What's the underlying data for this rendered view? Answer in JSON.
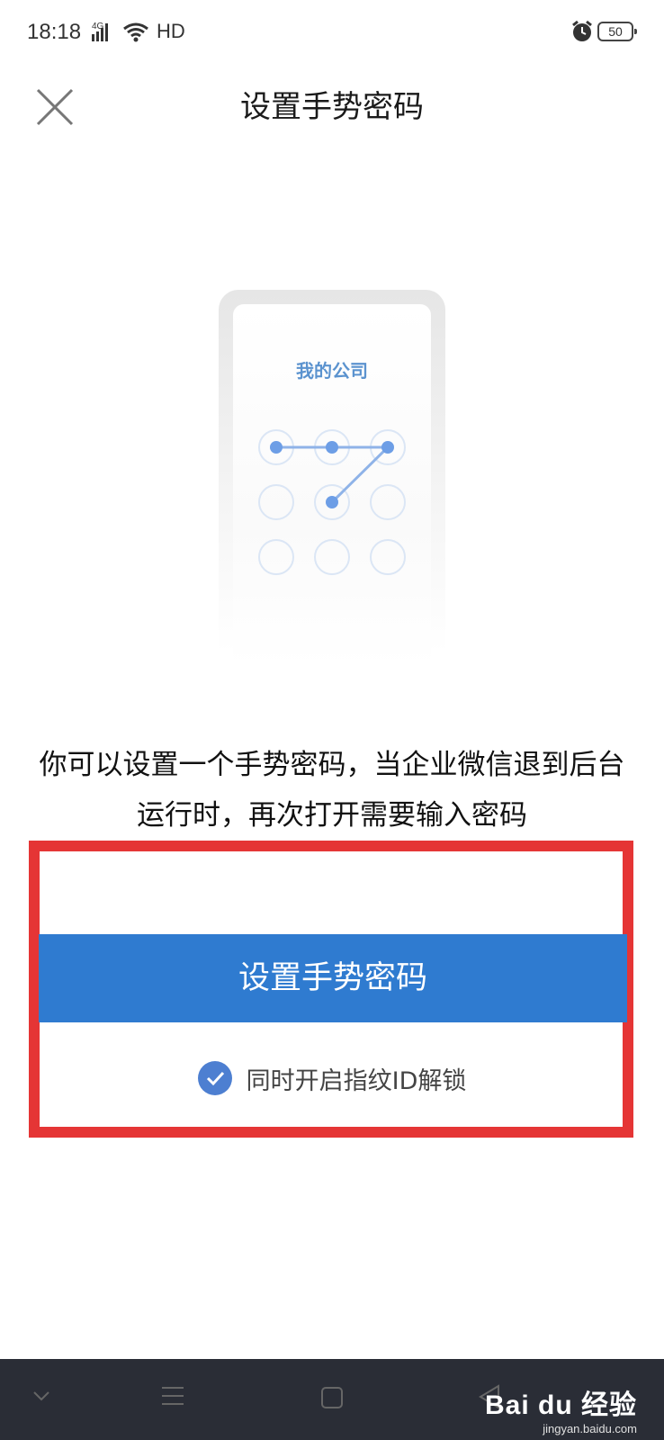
{
  "status_bar": {
    "time": "18:18",
    "network": "4G",
    "hd": "HD",
    "battery": "50"
  },
  "nav": {
    "title": "设置手势密码"
  },
  "illustration": {
    "company_name": "我的公司"
  },
  "description": "你可以设置一个手势密码，当企业微信退到后台运行时，再次打开需要输入密码",
  "primary_button_label": "设置手势密码",
  "fingerprint": {
    "label": "同时开启指纹ID解锁",
    "checked": true
  },
  "watermark": {
    "brand": "Bai du 经验",
    "url": "jingyan.baidu.com"
  },
  "colors": {
    "accent": "#2f7bd0",
    "highlight_border": "#e53535",
    "nav_bar": "#2a2d36"
  },
  "icons": [
    "close-icon",
    "check-icon",
    "alarm-icon",
    "wifi-icon",
    "signal-icon",
    "back-icon",
    "home-icon",
    "menu-icon",
    "collapse-icon"
  ]
}
